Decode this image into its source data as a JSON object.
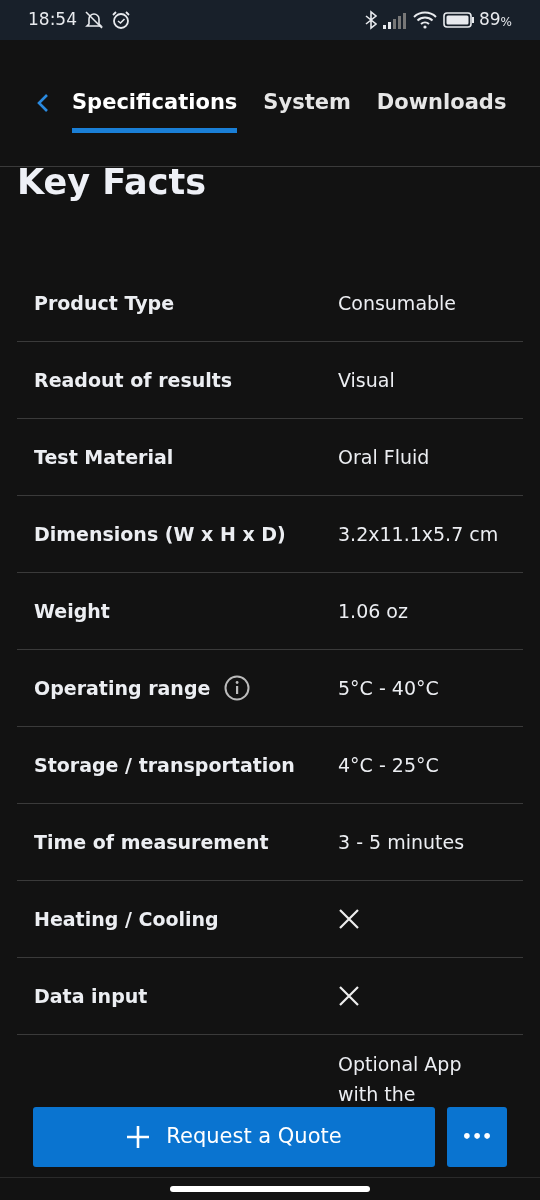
{
  "status_bar": {
    "time": "18:54",
    "battery": "89",
    "battery_unit": "%"
  },
  "tabs": [
    {
      "label": "Specifications",
      "selected": true
    },
    {
      "label": "System",
      "selected": false
    },
    {
      "label": "Downloads",
      "selected": false
    }
  ],
  "title": "Key Facts",
  "rows": [
    {
      "label": "Product Type",
      "kind": "text",
      "value": "Consumable"
    },
    {
      "label": "Readout of results",
      "kind": "text",
      "value": "Visual"
    },
    {
      "label": "Test Material",
      "kind": "text",
      "value": "Oral Fluid"
    },
    {
      "label": "Dimensions (W x H x D)",
      "kind": "text",
      "value": "3.2x11.1x5.7 cm"
    },
    {
      "label": "Weight",
      "kind": "text",
      "value": "1.06 oz"
    },
    {
      "label": "Operating range",
      "kind": "text",
      "info": true,
      "value": "5°C - 40°C"
    },
    {
      "label": "Storage / transportation",
      "kind": "text",
      "value": "4°C - 25°C"
    },
    {
      "label": "Time of measurement",
      "kind": "text",
      "value": "3 - 5 minutes"
    },
    {
      "label": "Heating / Cooling",
      "kind": "cross"
    },
    {
      "label": "Data input",
      "kind": "cross"
    },
    {
      "label": "",
      "kind": "text",
      "value": "Optional App\nwith the"
    }
  ],
  "actions": {
    "primary": "Request a Quote",
    "more": "•••"
  }
}
